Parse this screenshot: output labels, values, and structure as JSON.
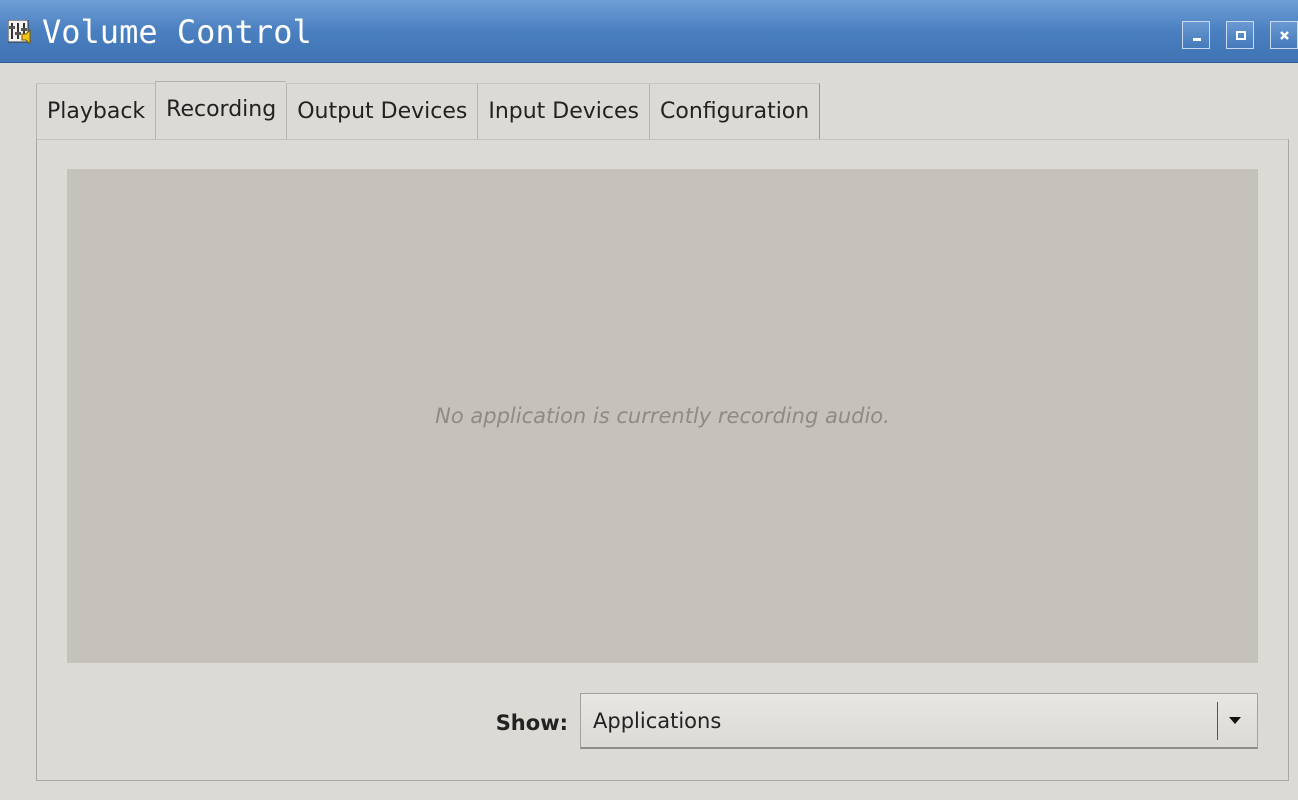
{
  "window": {
    "title": "Volume Control"
  },
  "icons": {
    "app": "volume-control-icon",
    "minimize": "minimize-icon",
    "maximize": "maximize-icon",
    "close": "close-icon",
    "dropdown": "chevron-down-icon"
  },
  "tabs": [
    {
      "label": "Playback"
    },
    {
      "label": "Recording"
    },
    {
      "label": "Output Devices"
    },
    {
      "label": "Input Devices"
    },
    {
      "label": "Configuration"
    }
  ],
  "active_tab": "Recording",
  "recording": {
    "empty_message": "No application is currently recording audio.",
    "show_label": "Show:",
    "show_value": "Applications"
  },
  "colors": {
    "titlebar": "#4a7fc0",
    "window_bg": "#dcdad5",
    "list_bg": "#c5c2bb"
  }
}
